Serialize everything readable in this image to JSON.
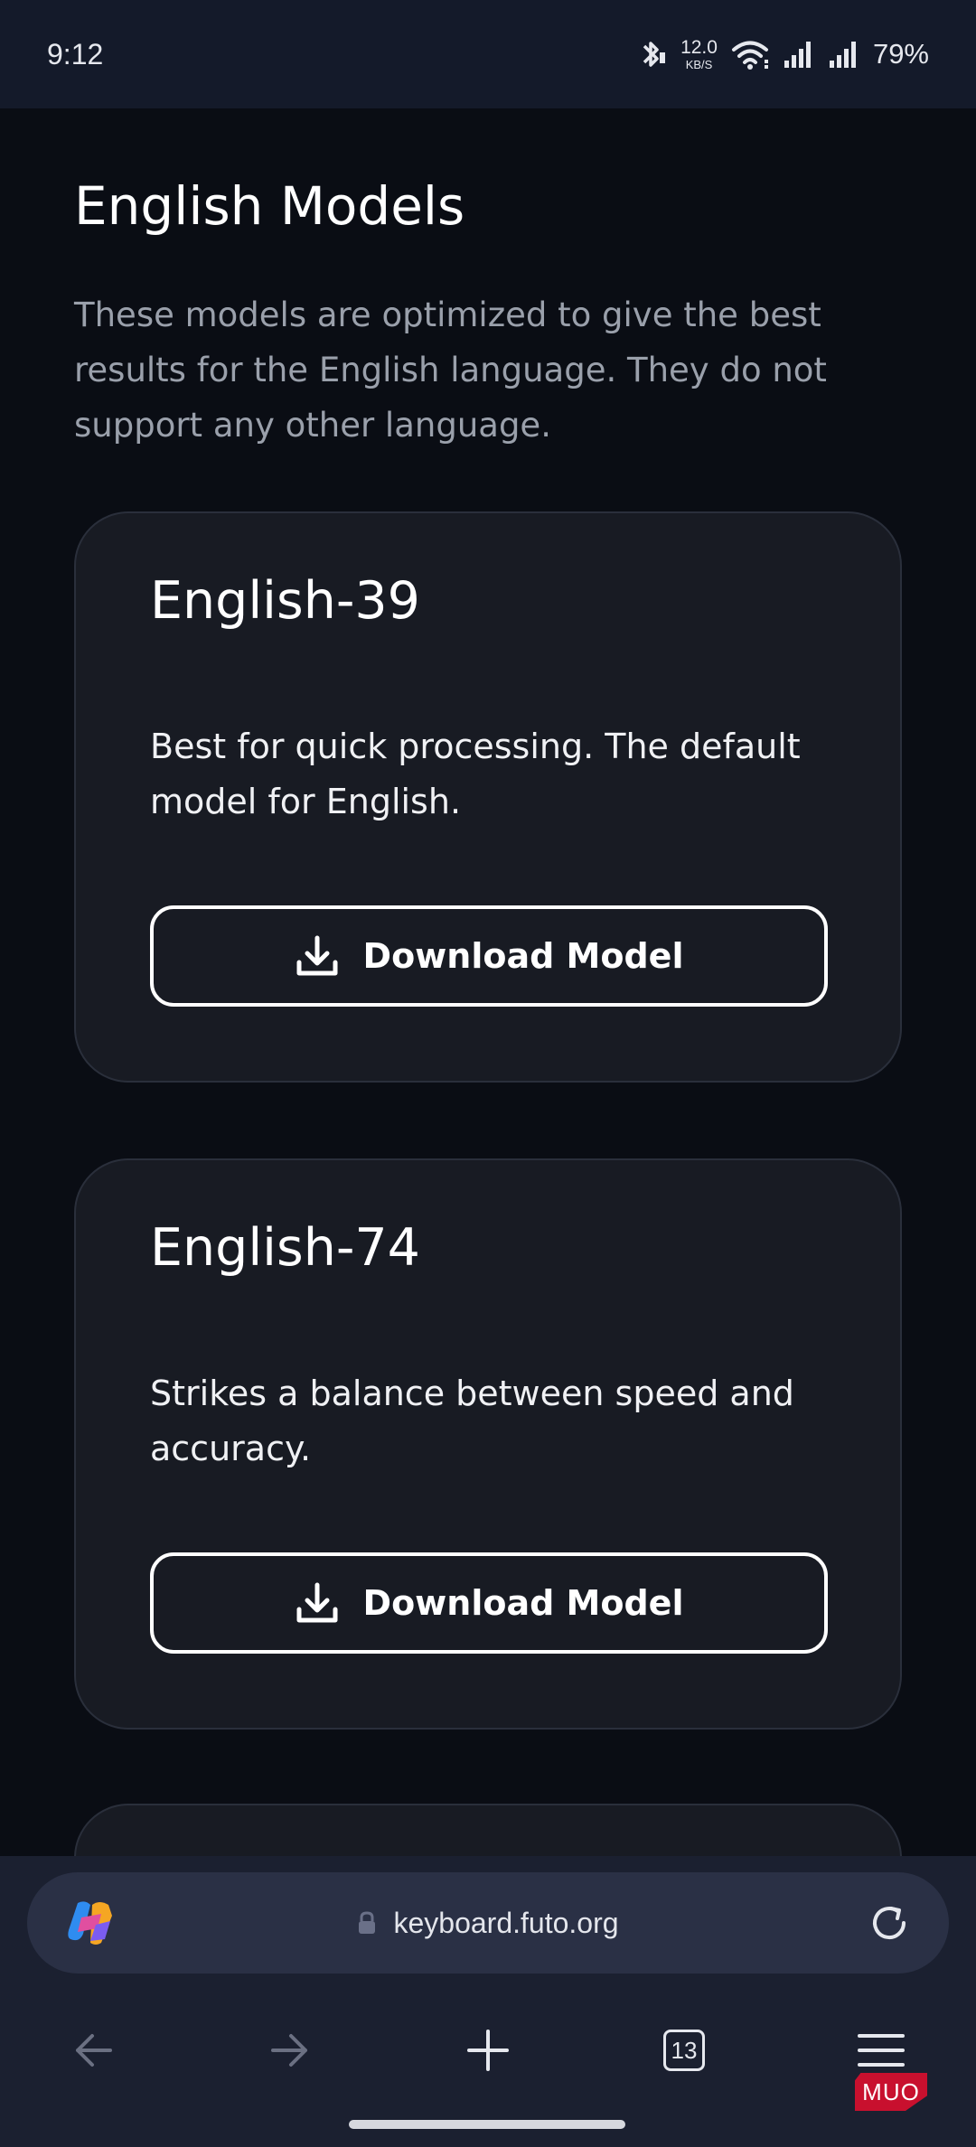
{
  "status_bar": {
    "time": "9:12",
    "net_speed_value": "12.0",
    "net_speed_unit": "KB/S",
    "battery": "79%"
  },
  "page": {
    "section_title": "English Models",
    "section_description": "These models are optimized to give the best results for the English language. They do not support any other language.",
    "models": [
      {
        "name": "English-39",
        "description": "Best for quick processing. The default model for English.",
        "button_label": "Download Model"
      },
      {
        "name": "English-74",
        "description": "Strikes a balance between speed and accuracy.",
        "button_label": "Download Model"
      }
    ]
  },
  "browser": {
    "url": "keyboard.futo.org",
    "tab_count": "13",
    "icons": [
      "copilot-icon",
      "lock-icon",
      "reload-icon",
      "back-arrow-icon",
      "forward-arrow-icon",
      "plus-icon",
      "tabs-icon",
      "menu-icon"
    ]
  },
  "watermark": "MUO",
  "colors": {
    "background": "#0a0d14",
    "card": "#181b23",
    "browser_bar": "#1b2030",
    "url_pill": "#2a3045",
    "text_muted": "#9aa0ab"
  }
}
